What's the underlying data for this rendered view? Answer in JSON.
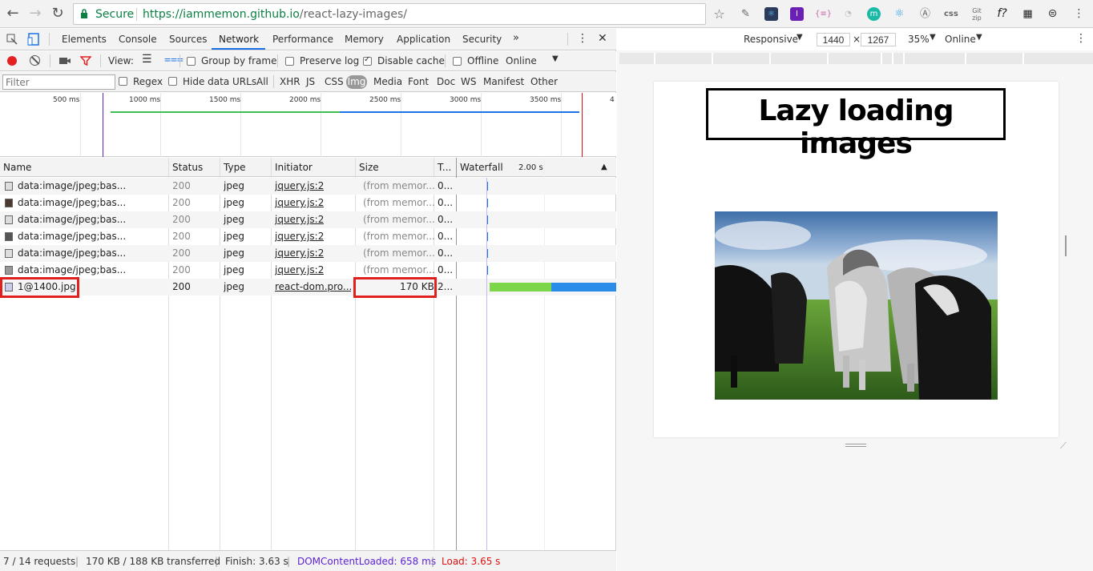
{
  "browser": {
    "secure_label": "Secure",
    "url_host": "https://iammemon.github.io",
    "url_path": "/react-lazy-images/",
    "extensions": [
      "{≡}",
      "m",
      "Ⓐ",
      "css",
      "Git zip",
      "f?"
    ]
  },
  "devtools": {
    "tabs": [
      "Elements",
      "Console",
      "Sources",
      "Network",
      "Performance",
      "Memory",
      "Application",
      "Security"
    ],
    "more_tabs": "»",
    "controls": {
      "view_label": "View:",
      "group_by_frame": "Group by frame",
      "preserve_log": "Preserve log",
      "disable_cache": "Disable cache",
      "offline": "Offline",
      "throttle": "Online"
    },
    "filter": {
      "placeholder": "Filter",
      "regex": "Regex",
      "hide_data_urls": "Hide data URLs",
      "types": [
        "All",
        "XHR",
        "JS",
        "CSS",
        "Img",
        "Media",
        "Font",
        "Doc",
        "WS",
        "Manifest",
        "Other"
      ]
    },
    "overview_ticks": [
      "500 ms",
      "1000 ms",
      "1500 ms",
      "2000 ms",
      "2500 ms",
      "3000 ms",
      "3500 ms",
      "4"
    ],
    "columns": {
      "name": "Name",
      "status": "Status",
      "type": "Type",
      "initiator": "Initiator",
      "size": "Size",
      "time": "T...",
      "waterfall": "Waterfall",
      "waterfall_time": "2.00 s"
    },
    "rows": [
      {
        "name": "data:image/jpeg;bas...",
        "status": "200",
        "type": "jpeg",
        "initiator": "jquery.js:2",
        "size": "(from memor...",
        "time": "0..."
      },
      {
        "name": "data:image/jpeg;bas...",
        "status": "200",
        "type": "jpeg",
        "initiator": "jquery.js:2",
        "size": "(from memor...",
        "time": "0..."
      },
      {
        "name": "data:image/jpeg;bas...",
        "status": "200",
        "type": "jpeg",
        "initiator": "jquery.js:2",
        "size": "(from memor...",
        "time": "0..."
      },
      {
        "name": "data:image/jpeg;bas...",
        "status": "200",
        "type": "jpeg",
        "initiator": "jquery.js:2",
        "size": "(from memor...",
        "time": "0..."
      },
      {
        "name": "data:image/jpeg;bas...",
        "status": "200",
        "type": "jpeg",
        "initiator": "jquery.js:2",
        "size": "(from memor...",
        "time": "0..."
      },
      {
        "name": "data:image/jpeg;bas...",
        "status": "200",
        "type": "jpeg",
        "initiator": "jquery.js:2",
        "size": "(from memor...",
        "time": "0..."
      },
      {
        "name": "1@1400.jpg",
        "status": "200",
        "type": "jpeg",
        "initiator": "react-dom.pro...",
        "size": "170 KB",
        "time": "2..."
      }
    ],
    "status": {
      "requests": "7 / 14 requests",
      "transferred": "170 KB / 188 KB transferred",
      "finish": "Finish: 3.63 s",
      "dcl": "DOMContentLoaded: 658 ms",
      "load": "Load: 3.65 s"
    }
  },
  "device": {
    "mode": "Responsive",
    "width": "1440",
    "times": "×",
    "height": "1267",
    "zoom": "35%",
    "throttle": "Online"
  },
  "page": {
    "title": "Lazy loading images"
  },
  "colors": {
    "accent": "#1a73e8",
    "secure_green": "#0b8043",
    "dcl": "#5a1fd6",
    "load": "#d11",
    "highlight": "#e0201d"
  }
}
